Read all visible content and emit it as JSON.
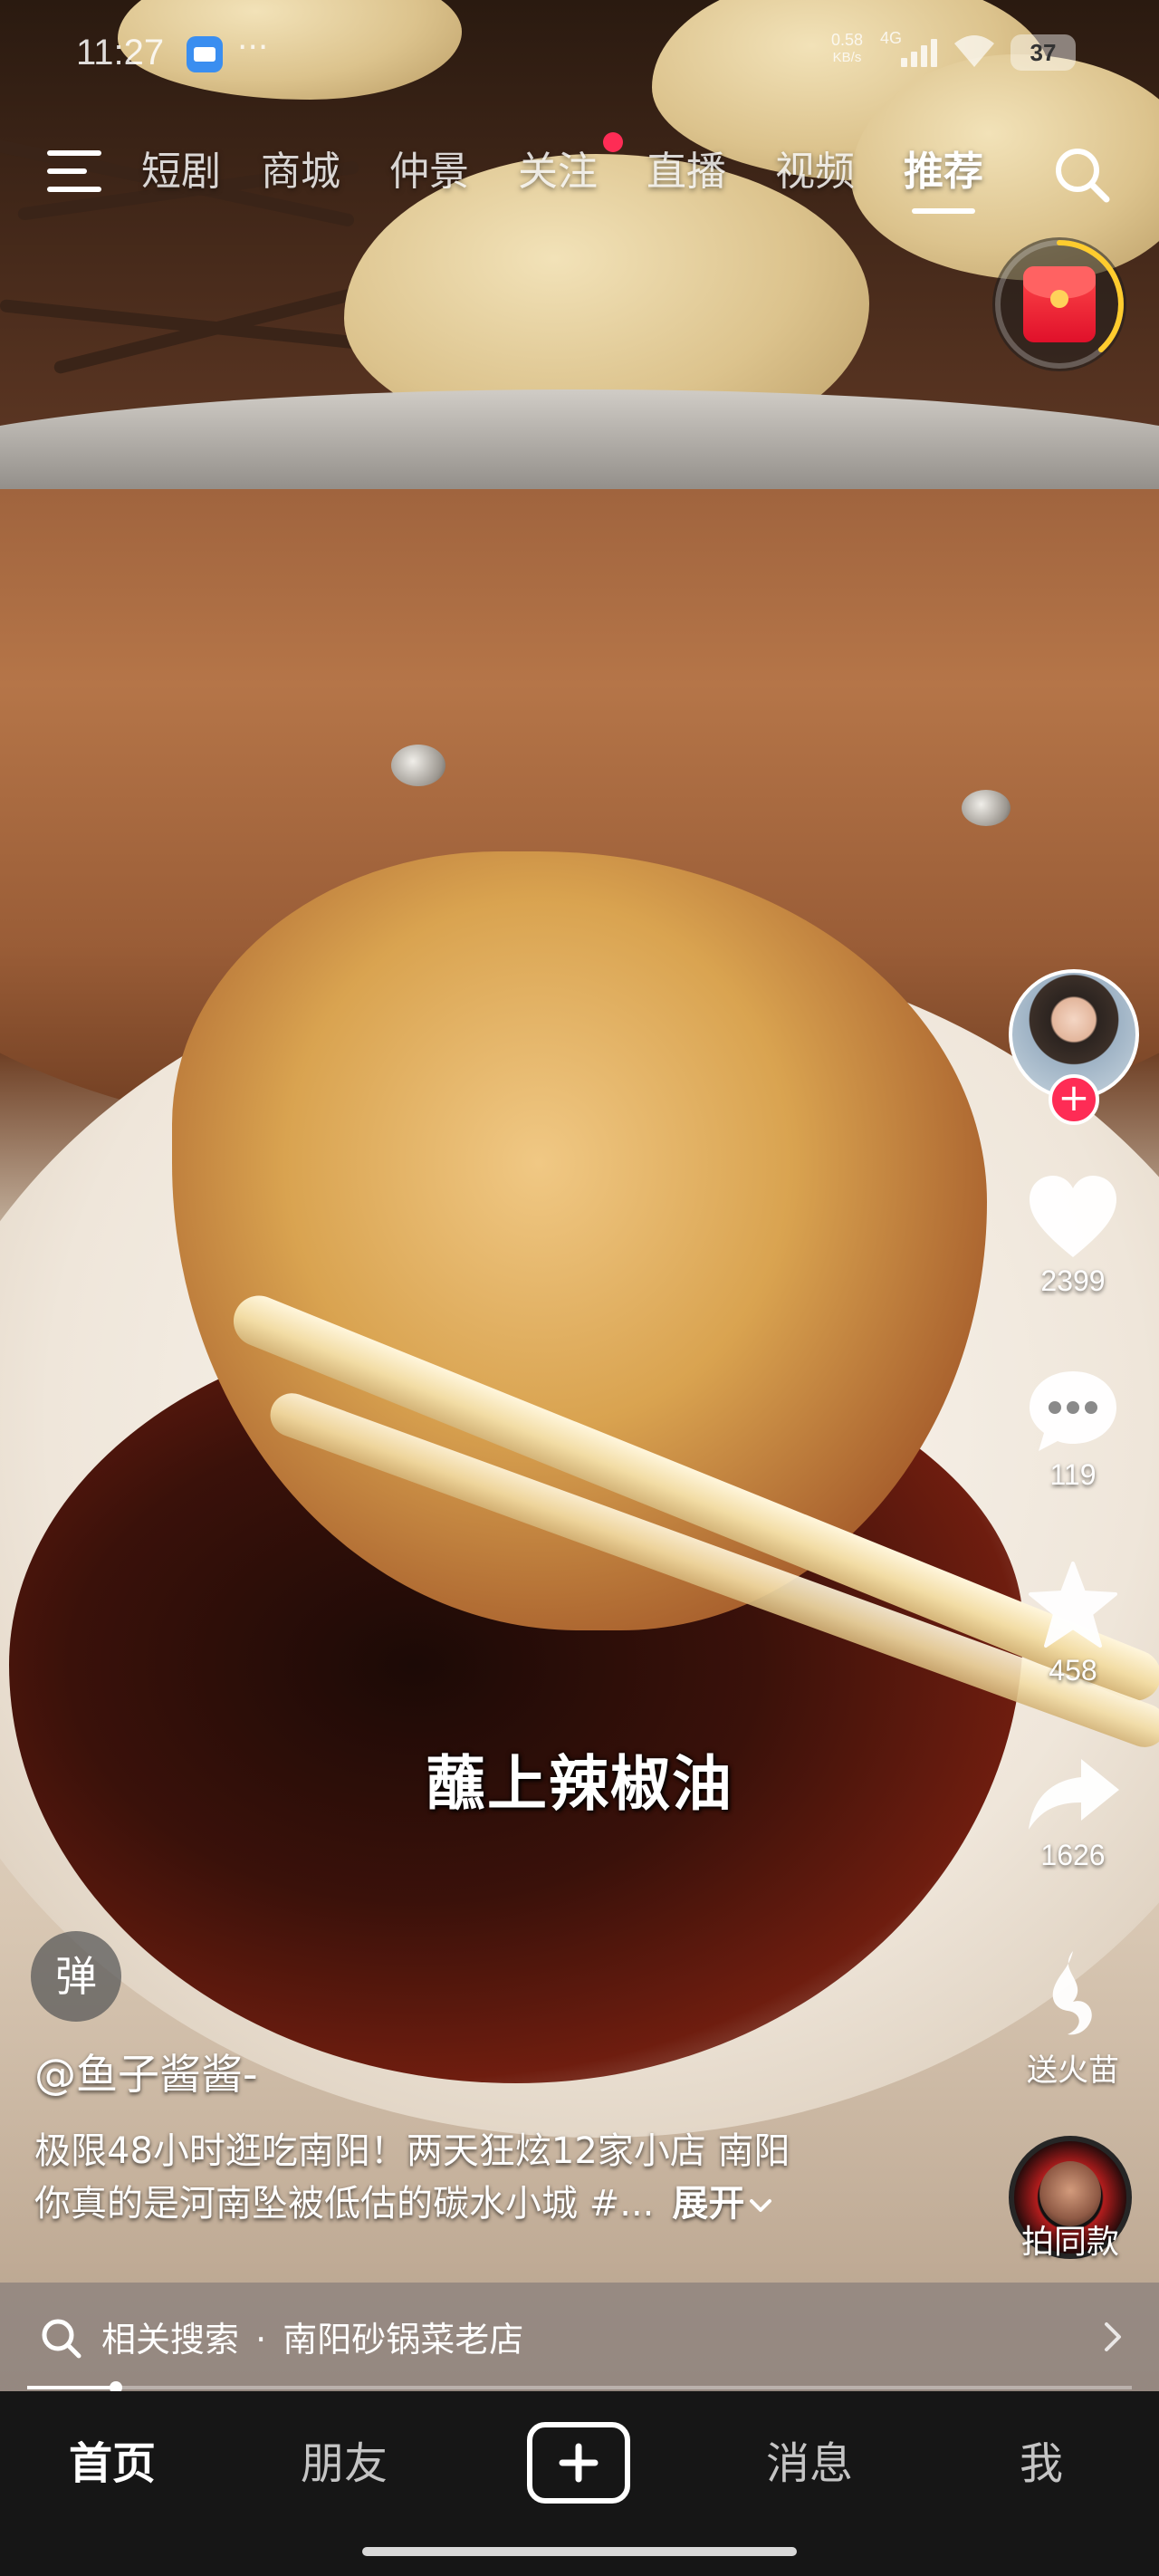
{
  "status_bar": {
    "time": "11:27",
    "dots": "···",
    "net_speed": "0.58",
    "net_unit": "KB/s",
    "net_type": "4G",
    "battery": "37"
  },
  "top_nav": {
    "tabs": [
      {
        "label": "短剧"
      },
      {
        "label": "商城"
      },
      {
        "label": "仲景"
      },
      {
        "label": "关注"
      },
      {
        "label": "直播"
      },
      {
        "label": "视频"
      },
      {
        "label": "推荐"
      }
    ],
    "active_tab": "推荐"
  },
  "video": {
    "subtitle": "蘸上辣椒油",
    "author": "@鱼子酱酱-",
    "description_line1": "极限48小时逛吃南阳！两天狂炫12家小店 南阳",
    "description_line2": "你真的是河南坠被低估的碳水小城 #...",
    "expand_label": "展开",
    "danmu_label": "弹",
    "progress": 0.08
  },
  "actions": {
    "follow_symbol": "+",
    "likes": "2399",
    "comments": "119",
    "favorites": "458",
    "shares": "1626",
    "gift_label": "送火苗",
    "same_style_label": "拍同款"
  },
  "related_search": {
    "label": "相关搜索",
    "separator": "·",
    "query": "南阳砂锅菜老店"
  },
  "bottom_tabs": [
    {
      "label": "首页"
    },
    {
      "label": "朋友"
    },
    {
      "label": "消息"
    },
    {
      "label": "我"
    }
  ],
  "icons": {
    "menu": "menu-icon",
    "search": "search-icon",
    "like": "heart-icon",
    "comment": "comment-icon",
    "favorite": "star-icon",
    "share": "share-icon",
    "gift": "flame-icon",
    "create": "plus-icon"
  },
  "colors": {
    "accent_red": "#fe2c55",
    "tabbar_bg": "#161616",
    "related_bg": "#8c827d"
  }
}
